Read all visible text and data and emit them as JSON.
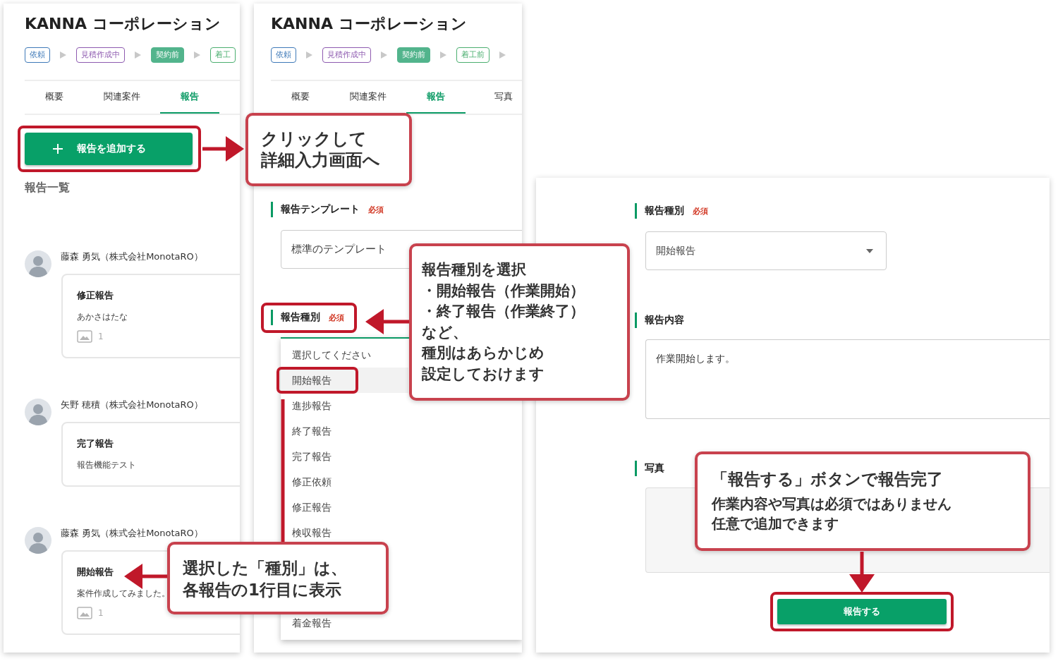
{
  "panel_list": {
    "title": "KANNA コーポレーション",
    "steps": [
      {
        "label": "依頼",
        "color": "#3f7ab8",
        "selected": false
      },
      {
        "label": "見積作成中",
        "color": "#8e5bb0",
        "selected": false
      },
      {
        "label": "契約前",
        "color": "#52b48c",
        "selected": true
      },
      {
        "label": "着工",
        "color": "#4caf70",
        "selected": false
      }
    ],
    "tabs": [
      {
        "label": "概要",
        "selected": false
      },
      {
        "label": "関連案件",
        "selected": false
      },
      {
        "label": "報告",
        "selected": true
      }
    ],
    "add_button": "報告を追加する",
    "list_heading": "報告一覧",
    "reports": [
      {
        "author": "藤森 勇気（株式会社MonotaRO）",
        "title": "修正報告",
        "body": "あかさはたな",
        "photos": "1"
      },
      {
        "author": "矢野 穂積（株式会社MonotaRO）",
        "title": "完了報告",
        "body": "報告機能テスト"
      },
      {
        "author": "藤森 勇気（株式会社MonotaRO）",
        "title": "開始報告",
        "body": "案件作成してみました。",
        "photos": "1"
      }
    ]
  },
  "panel_type_dropdown": {
    "title": "KANNA コーポレーション",
    "steps": [
      {
        "label": "依頼",
        "color": "#3f7ab8",
        "selected": false
      },
      {
        "label": "見積作成中",
        "color": "#8e5bb0",
        "selected": false
      },
      {
        "label": "契約前",
        "color": "#52b48c",
        "selected": true
      },
      {
        "label": "着工前",
        "color": "#4caf70",
        "selected": false
      }
    ],
    "trailing_arrow": true,
    "tabs": [
      {
        "label": "概要",
        "selected": false
      },
      {
        "label": "関連案件",
        "selected": false
      },
      {
        "label": "報告",
        "selected": true
      },
      {
        "label": "写真",
        "selected": false
      }
    ],
    "template_field": {
      "label": "報告テンプレート",
      "badge": "必須",
      "value": "標準のテンプレート"
    },
    "type_field": {
      "label": "報告種別",
      "badge": "必須",
      "options": [
        {
          "label": "選択してください",
          "selected": false
        },
        {
          "label": "開始報告",
          "selected": true
        },
        {
          "label": "進捗報告",
          "selected": false
        },
        {
          "label": "終了報告",
          "selected": false
        },
        {
          "label": "完了報告",
          "selected": false
        },
        {
          "label": "修正依頼",
          "selected": false
        },
        {
          "label": "修正報告",
          "selected": false
        },
        {
          "label": "検収報告",
          "selected": false
        },
        {
          "label": "着金報告",
          "selected": false
        }
      ]
    }
  },
  "panel_submit": {
    "type_field": {
      "label": "報告種別",
      "badge": "必須",
      "value": "開始報告"
    },
    "content_field": {
      "label": "報告内容",
      "value": "作業開始します。"
    },
    "photo_field": {
      "label": "写真"
    },
    "submit_button": "報告する"
  },
  "callouts": [
    {
      "lines": [
        "クリックして",
        "詳細入力画面へ"
      ]
    },
    {
      "lines": [
        "報告種別を選択",
        "・開始報告（作業開始）",
        "・終了報告（作業終了）",
        "など、",
        "種別はあらかじめ",
        "設定しておけます"
      ]
    },
    {
      "lines": [
        "選択した「種別」は、",
        "各報告の1行目に表示"
      ]
    },
    {
      "heading": "「報告する」ボタンで報告完了",
      "lines": [
        "作業内容や写真は必須ではありません",
        "任意で追加できます"
      ]
    }
  ]
}
